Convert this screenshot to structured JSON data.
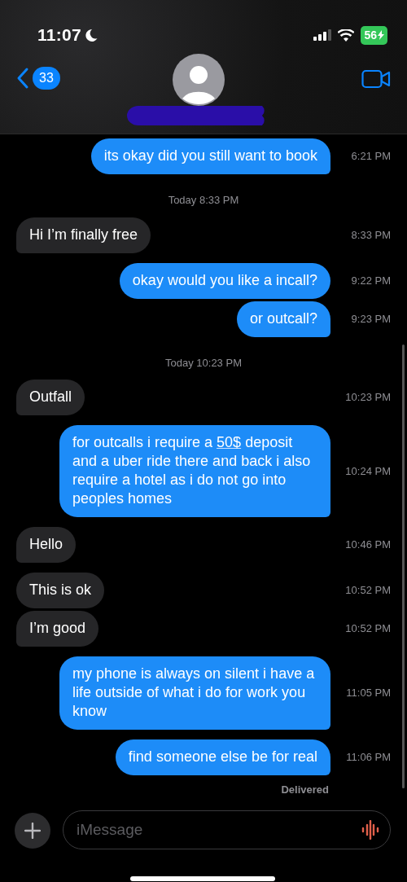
{
  "status_bar": {
    "time": "11:07",
    "battery": "56"
  },
  "header": {
    "unread_count": "33"
  },
  "thread": [
    {
      "kind": "sent",
      "parts": [
        {
          "text": "its okay did you still want to book"
        }
      ],
      "time": "6:21 PM",
      "tail": true
    },
    {
      "kind": "timestamp",
      "text": "Today 8:33 PM"
    },
    {
      "kind": "received",
      "parts": [
        {
          "text": "Hi I’m finally free"
        }
      ],
      "time": "8:33 PM",
      "tail": true
    },
    {
      "kind": "sent",
      "parts": [
        {
          "text": "okay would you like a incall?"
        }
      ],
      "time": "9:22 PM",
      "tail": false
    },
    {
      "kind": "sent",
      "parts": [
        {
          "text": "or outcall?"
        }
      ],
      "time": "9:23 PM",
      "tail": true
    },
    {
      "kind": "timestamp",
      "text": "Today 10:23 PM"
    },
    {
      "kind": "received",
      "parts": [
        {
          "text": "Outfall"
        }
      ],
      "time": "10:23 PM",
      "tail": true
    },
    {
      "kind": "sent",
      "parts": [
        {
          "text": "for outcalls i require a "
        },
        {
          "text": "50$",
          "link": true
        },
        {
          "text": " deposit and a uber ride there and back i also require a hotel as i do not go into peoples homes"
        }
      ],
      "time": "10:24 PM",
      "tail": true
    },
    {
      "kind": "received",
      "parts": [
        {
          "text": "Hello"
        }
      ],
      "time": "10:46 PM",
      "tail": true
    },
    {
      "kind": "received",
      "parts": [
        {
          "text": "This is ok"
        }
      ],
      "time": "10:52 PM",
      "tail": false
    },
    {
      "kind": "received",
      "parts": [
        {
          "text": "I’m good"
        }
      ],
      "time": "10:52 PM",
      "tail": true
    },
    {
      "kind": "sent",
      "parts": [
        {
          "text": "my phone is always on silent i have a life outside of what i do for work you know"
        }
      ],
      "time": "11:05 PM",
      "tail": true
    },
    {
      "kind": "sent",
      "parts": [
        {
          "text": "find someone else be for real"
        }
      ],
      "time": "11:06 PM",
      "tail": true
    },
    {
      "kind": "status",
      "text": "Delivered"
    }
  ],
  "composer": {
    "placeholder": "iMessage"
  }
}
